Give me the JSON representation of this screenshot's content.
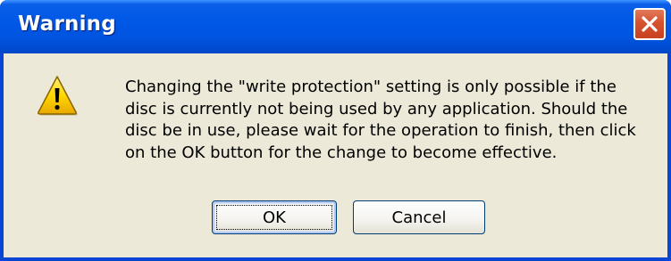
{
  "dialog": {
    "title": "Warning",
    "icon": "warning-icon",
    "message_lines": [
      "Changing the \"write protection\" setting is only possible if the",
      "disc is currently not being used by any application. Should the",
      "disc be in use, please wait for the operation to finish, then click",
      "on the OK button for the change to become effective."
    ],
    "buttons": {
      "ok_label": "OK",
      "cancel_label": "Cancel"
    }
  },
  "colors": {
    "titlebar": "#0054e0",
    "body": "#ece9d8",
    "close_button": "#d5522f",
    "warning_fill": "#ffd800"
  }
}
